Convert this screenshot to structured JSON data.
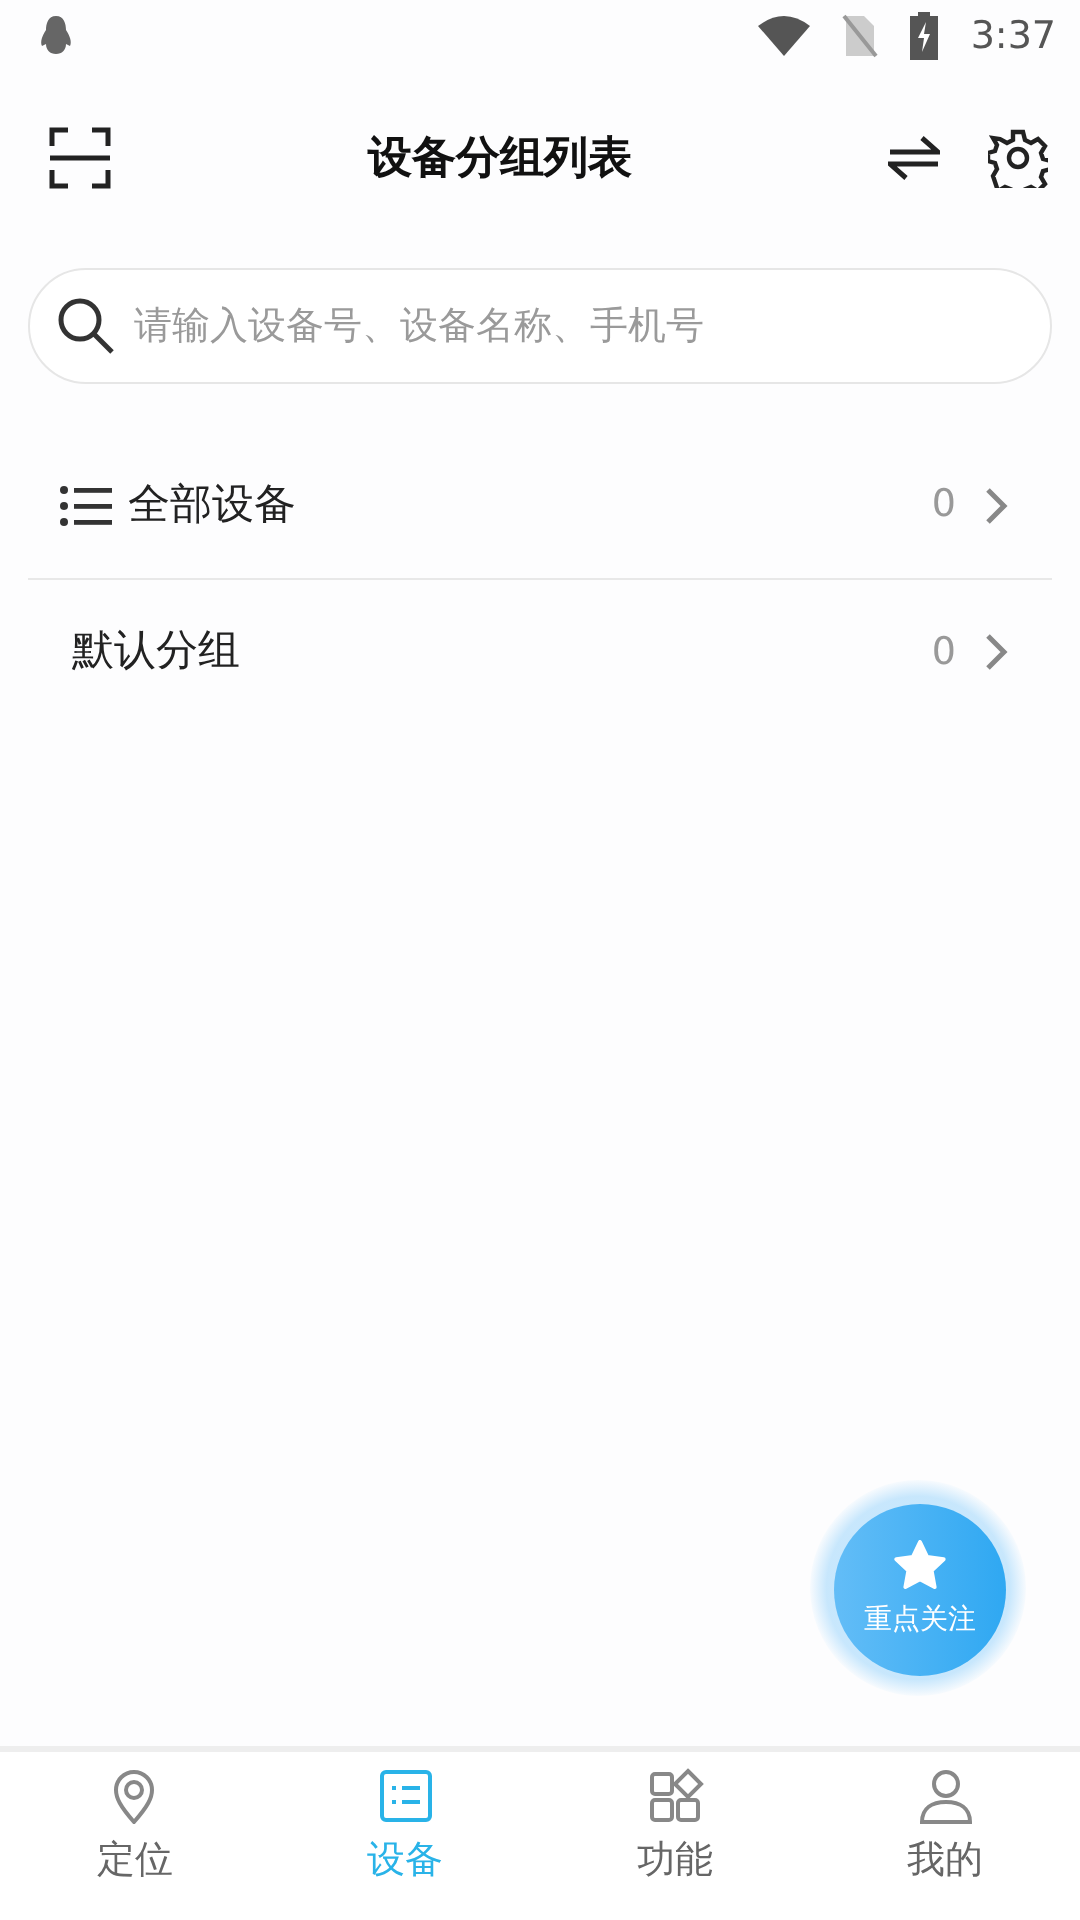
{
  "status_bar": {
    "time": "3:37"
  },
  "header": {
    "title": "设备分组列表"
  },
  "search": {
    "placeholder": "请输入设备号、设备名称、手机号"
  },
  "groups": [
    {
      "kind": "all",
      "name": "全部设备",
      "count": "0"
    },
    {
      "kind": "plain",
      "name": "默认分组",
      "count": "0"
    }
  ],
  "fab": {
    "label": "重点关注"
  },
  "tabs": [
    {
      "kind": "location",
      "label": "定位",
      "selected": false
    },
    {
      "kind": "device",
      "label": "设备",
      "selected": true
    },
    {
      "kind": "apps",
      "label": "功能",
      "selected": false
    },
    {
      "kind": "profile",
      "label": "我的",
      "selected": false
    }
  ]
}
